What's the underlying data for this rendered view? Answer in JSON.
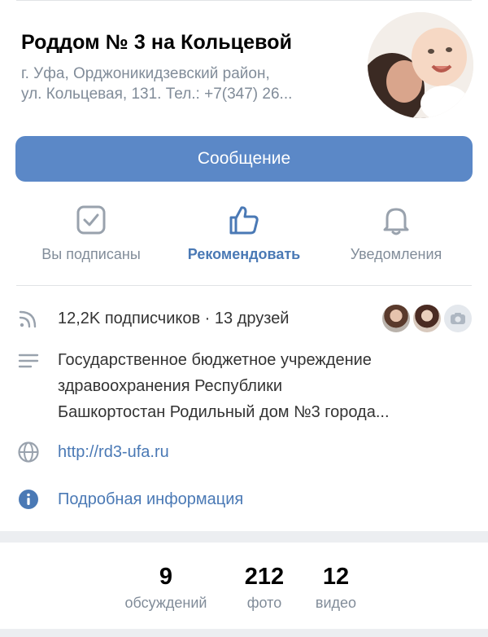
{
  "header": {
    "title": "Роддом № 3 на Кольцевой",
    "address_line1": "г. Уфа, Орджоникидзевский район,",
    "address_line2": "ул. Кольцевая, 131. Тел.: +7(347) 26..."
  },
  "message_button": {
    "label": "Сообщение"
  },
  "actions": [
    {
      "label": "Вы подписаны",
      "icon": "checkbox-icon"
    },
    {
      "label": "Рекомендовать",
      "icon": "thumbs-up-icon"
    },
    {
      "label": "Уведомления",
      "icon": "bell-icon"
    }
  ],
  "info": {
    "subscribers": "12,2K подписчиков · 13 друзей",
    "description_lines": [
      "Государственное бюджетное учреждение",
      "здравоохранения Республики",
      "Башкортостан Родильный дом №3 города..."
    ],
    "website": "http://rd3-ufa.ru",
    "details": "Подробная информация"
  },
  "counters": [
    {
      "value": "9",
      "caption": "обсуждений"
    },
    {
      "value": "212",
      "caption": "фото"
    },
    {
      "value": "12",
      "caption": "видео"
    }
  ],
  "colors": {
    "accent": "#4a79b5",
    "button": "#5b88c7",
    "secondary_text": "#818c99",
    "icon_gray": "#99a2ad"
  }
}
